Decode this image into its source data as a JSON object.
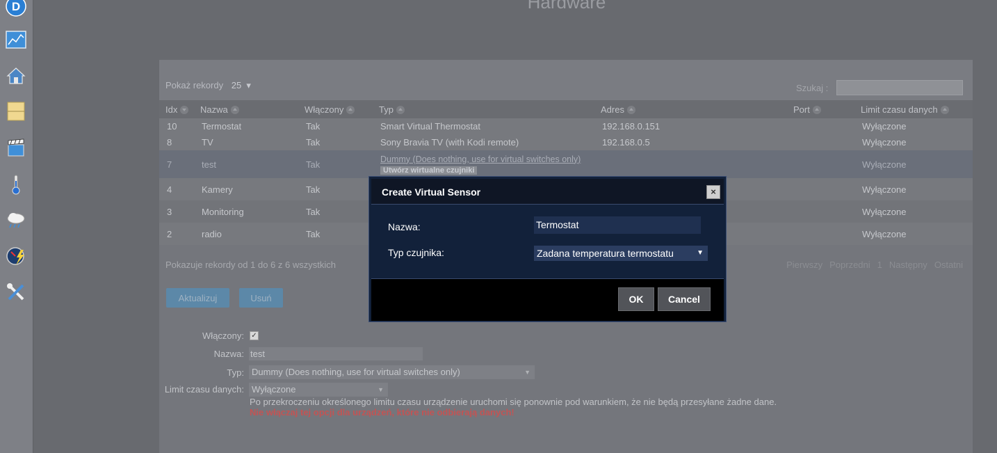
{
  "page_title": "Hardware",
  "toolbar": {
    "show_records_label": "Pokaż rekordy",
    "show_records_value": "25",
    "search_label": "Szukaj :"
  },
  "table": {
    "headers": [
      "Idx",
      "Nazwa",
      "Włączony",
      "Typ",
      "Adres",
      "Port",
      "Limit czasu danych"
    ],
    "rows": [
      {
        "idx": "10",
        "name": "Termostat",
        "enabled": "Tak",
        "type": "Smart Virtual Thermostat",
        "address": "192.168.0.151",
        "port": "",
        "timeout": "Wyłączone"
      },
      {
        "idx": "8",
        "name": "TV",
        "enabled": "Tak",
        "type": "Sony Bravia TV (with Kodi remote)",
        "address": "192.168.0.5",
        "port": "",
        "timeout": "Wyłączone"
      },
      {
        "idx": "7",
        "name": "test",
        "enabled": "Tak",
        "type": "Dummy (Does nothing, use for virtual switches only)",
        "address": "",
        "port": "",
        "timeout": "Wyłączone",
        "action": "Utwórz wirtualne czujniki"
      },
      {
        "idx": "4",
        "name": "Kamery",
        "enabled": "Tak",
        "type": "",
        "address": "",
        "port": "",
        "timeout": "Wyłączone"
      },
      {
        "idx": "3",
        "name": "Monitoring",
        "enabled": "Tak",
        "type": "",
        "address": "",
        "port": "",
        "timeout": "Wyłączone"
      },
      {
        "idx": "2",
        "name": "radio",
        "enabled": "Tak",
        "type": "",
        "address": "",
        "port": "",
        "timeout": "Wyłączone"
      }
    ]
  },
  "info_text": "Pokazuje rekordy od 1 do 6 z 6 wszystkich",
  "pager": {
    "first": "Pierwszy",
    "prev": "Poprzedni",
    "page": "1",
    "next": "Następny",
    "last": "Ostatni"
  },
  "buttons": {
    "update": "Aktualizuj",
    "delete": "Usuń"
  },
  "form": {
    "enabled_label": "Włączony:",
    "enabled_checked": true,
    "name_label": "Nazwa:",
    "name_value": "test",
    "type_label": "Typ:",
    "type_value": "Dummy (Does nothing, use for virtual switches only)",
    "timeout_label": "Limit czasu danych:",
    "timeout_value": "Wyłączone",
    "note": "Po przekroczeniu określonego limitu czasu urządzenie uruchomi się ponownie pod warunkiem, że nie będą przesyłane żadne dane.",
    "warning": "Nie włączaj tej opcji dla urządzeń, które nie odbierają danych!"
  },
  "modal": {
    "title": "Create Virtual Sensor",
    "close_label": "×",
    "name_label": "Nazwa:",
    "name_value": "Termostat",
    "type_label": "Typ czujnika:",
    "type_value": "Zadana temperatura termostatu",
    "ok_label": "OK",
    "cancel_label": "Cancel"
  },
  "sidebar_icons": [
    "domoticz-logo-icon",
    "dashboard-icon",
    "floorplan-icon",
    "light-switch-icon",
    "scenes-icon",
    "temperature-icon",
    "weather-icon",
    "utility-icon",
    "setup-icon"
  ]
}
